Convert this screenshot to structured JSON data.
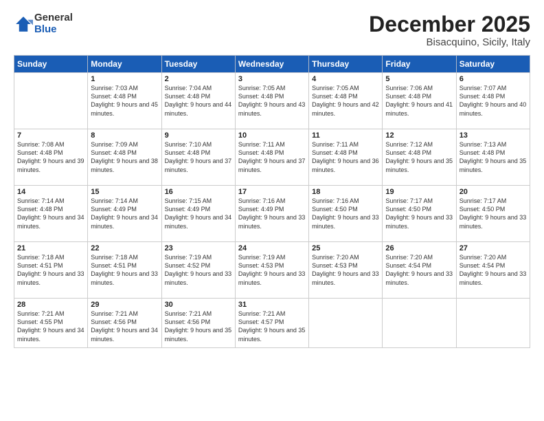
{
  "logo": {
    "general": "General",
    "blue": "Blue"
  },
  "header": {
    "month": "December 2025",
    "location": "Bisacquino, Sicily, Italy"
  },
  "days_of_week": [
    "Sunday",
    "Monday",
    "Tuesday",
    "Wednesday",
    "Thursday",
    "Friday",
    "Saturday"
  ],
  "weeks": [
    [
      {
        "day": "",
        "info": ""
      },
      {
        "day": "1",
        "info": "Sunrise: 7:03 AM\nSunset: 4:48 PM\nDaylight: 9 hours\nand 45 minutes."
      },
      {
        "day": "2",
        "info": "Sunrise: 7:04 AM\nSunset: 4:48 PM\nDaylight: 9 hours\nand 44 minutes."
      },
      {
        "day": "3",
        "info": "Sunrise: 7:05 AM\nSunset: 4:48 PM\nDaylight: 9 hours\nand 43 minutes."
      },
      {
        "day": "4",
        "info": "Sunrise: 7:05 AM\nSunset: 4:48 PM\nDaylight: 9 hours\nand 42 minutes."
      },
      {
        "day": "5",
        "info": "Sunrise: 7:06 AM\nSunset: 4:48 PM\nDaylight: 9 hours\nand 41 minutes."
      },
      {
        "day": "6",
        "info": "Sunrise: 7:07 AM\nSunset: 4:48 PM\nDaylight: 9 hours\nand 40 minutes."
      }
    ],
    [
      {
        "day": "7",
        "info": "Sunrise: 7:08 AM\nSunset: 4:48 PM\nDaylight: 9 hours\nand 39 minutes."
      },
      {
        "day": "8",
        "info": "Sunrise: 7:09 AM\nSunset: 4:48 PM\nDaylight: 9 hours\nand 38 minutes."
      },
      {
        "day": "9",
        "info": "Sunrise: 7:10 AM\nSunset: 4:48 PM\nDaylight: 9 hours\nand 37 minutes."
      },
      {
        "day": "10",
        "info": "Sunrise: 7:11 AM\nSunset: 4:48 PM\nDaylight: 9 hours\nand 37 minutes."
      },
      {
        "day": "11",
        "info": "Sunrise: 7:11 AM\nSunset: 4:48 PM\nDaylight: 9 hours\nand 36 minutes."
      },
      {
        "day": "12",
        "info": "Sunrise: 7:12 AM\nSunset: 4:48 PM\nDaylight: 9 hours\nand 35 minutes."
      },
      {
        "day": "13",
        "info": "Sunrise: 7:13 AM\nSunset: 4:48 PM\nDaylight: 9 hours\nand 35 minutes."
      }
    ],
    [
      {
        "day": "14",
        "info": "Sunrise: 7:14 AM\nSunset: 4:48 PM\nDaylight: 9 hours\nand 34 minutes."
      },
      {
        "day": "15",
        "info": "Sunrise: 7:14 AM\nSunset: 4:49 PM\nDaylight: 9 hours\nand 34 minutes."
      },
      {
        "day": "16",
        "info": "Sunrise: 7:15 AM\nSunset: 4:49 PM\nDaylight: 9 hours\nand 34 minutes."
      },
      {
        "day": "17",
        "info": "Sunrise: 7:16 AM\nSunset: 4:49 PM\nDaylight: 9 hours\nand 33 minutes."
      },
      {
        "day": "18",
        "info": "Sunrise: 7:16 AM\nSunset: 4:50 PM\nDaylight: 9 hours\nand 33 minutes."
      },
      {
        "day": "19",
        "info": "Sunrise: 7:17 AM\nSunset: 4:50 PM\nDaylight: 9 hours\nand 33 minutes."
      },
      {
        "day": "20",
        "info": "Sunrise: 7:17 AM\nSunset: 4:50 PM\nDaylight: 9 hours\nand 33 minutes."
      }
    ],
    [
      {
        "day": "21",
        "info": "Sunrise: 7:18 AM\nSunset: 4:51 PM\nDaylight: 9 hours\nand 33 minutes."
      },
      {
        "day": "22",
        "info": "Sunrise: 7:18 AM\nSunset: 4:51 PM\nDaylight: 9 hours\nand 33 minutes."
      },
      {
        "day": "23",
        "info": "Sunrise: 7:19 AM\nSunset: 4:52 PM\nDaylight: 9 hours\nand 33 minutes."
      },
      {
        "day": "24",
        "info": "Sunrise: 7:19 AM\nSunset: 4:53 PM\nDaylight: 9 hours\nand 33 minutes."
      },
      {
        "day": "25",
        "info": "Sunrise: 7:20 AM\nSunset: 4:53 PM\nDaylight: 9 hours\nand 33 minutes."
      },
      {
        "day": "26",
        "info": "Sunrise: 7:20 AM\nSunset: 4:54 PM\nDaylight: 9 hours\nand 33 minutes."
      },
      {
        "day": "27",
        "info": "Sunrise: 7:20 AM\nSunset: 4:54 PM\nDaylight: 9 hours\nand 33 minutes."
      }
    ],
    [
      {
        "day": "28",
        "info": "Sunrise: 7:21 AM\nSunset: 4:55 PM\nDaylight: 9 hours\nand 34 minutes."
      },
      {
        "day": "29",
        "info": "Sunrise: 7:21 AM\nSunset: 4:56 PM\nDaylight: 9 hours\nand 34 minutes."
      },
      {
        "day": "30",
        "info": "Sunrise: 7:21 AM\nSunset: 4:56 PM\nDaylight: 9 hours\nand 35 minutes."
      },
      {
        "day": "31",
        "info": "Sunrise: 7:21 AM\nSunset: 4:57 PM\nDaylight: 9 hours\nand 35 minutes."
      },
      {
        "day": "",
        "info": ""
      },
      {
        "day": "",
        "info": ""
      },
      {
        "day": "",
        "info": ""
      }
    ]
  ]
}
